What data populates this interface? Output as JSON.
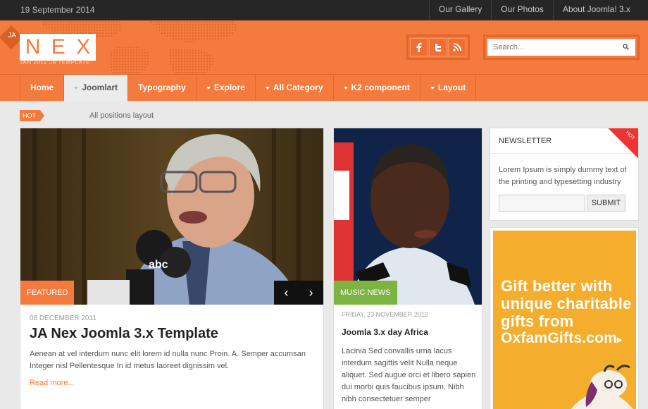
{
  "topbar": {
    "date": "19 September 2014",
    "links": [
      "Our Gallery",
      "Our Photos",
      "About Joomla! 3.x"
    ]
  },
  "header": {
    "ja_badge": "JA",
    "logo_letters": [
      "N",
      "E",
      "X"
    ],
    "logo_sub": "JAN 2012 JA TEMPLATE",
    "social_icons": [
      "facebook-icon",
      "twitter-icon",
      "rss-icon"
    ],
    "search_placeholder": "Search..."
  },
  "nav": {
    "items": [
      {
        "label": "Home",
        "caret": false,
        "active": false
      },
      {
        "label": "Joomlart",
        "caret": true,
        "active": true
      },
      {
        "label": "Typography",
        "caret": false,
        "active": false
      },
      {
        "label": "Explore",
        "caret": true,
        "active": false
      },
      {
        "label": "All Category",
        "caret": true,
        "active": false
      },
      {
        "label": "K2 component",
        "caret": true,
        "active": false
      },
      {
        "label": "Layout",
        "caret": true,
        "active": false
      }
    ]
  },
  "hotline": {
    "badge": "HOT",
    "text": "All positions layout"
  },
  "featured": {
    "tag": "FEATURED",
    "prev": "‹",
    "next": "›",
    "date": "08 DECEMBER 2011",
    "title": "JA Nex Joomla 3.x Template",
    "text": "Aenean at vel interdum nunc elit lorem id nulla nunc Proin. A. Semper accumsan Integer nisl Pellentesque In id metus laoreet dignissim vel.",
    "more": "Read more..."
  },
  "music": {
    "tag": "MUSIC NEWS",
    "date": "FRIDAY, 23 NOVEMBER 2012",
    "title": "Joomla 3.x day Africa",
    "text": "Lacinia Sed convallis urna lacus interdum sagittis velit Nulla neque aliquet. Sed augue orci et libero sapien dui morbi quis faucibus ipsum. Nibh nibh consectetuer semper"
  },
  "newsletter": {
    "title": "NEWSLETTER",
    "corner": "HOT",
    "text": "Lorem Ipsum is simply dummy text of the printing and typesetting industry",
    "submit": "SUBMIT"
  },
  "ad": {
    "lines": [
      "Gift better with",
      "unique charitable",
      "gifts from",
      "OxfamGifts.com"
    ],
    "arrow": "▸"
  },
  "colors": {
    "brand_orange": "#f47a3d",
    "topbar_dark": "#262626",
    "music_green": "#7cb342",
    "ad_yellow": "#f5ad2e"
  }
}
